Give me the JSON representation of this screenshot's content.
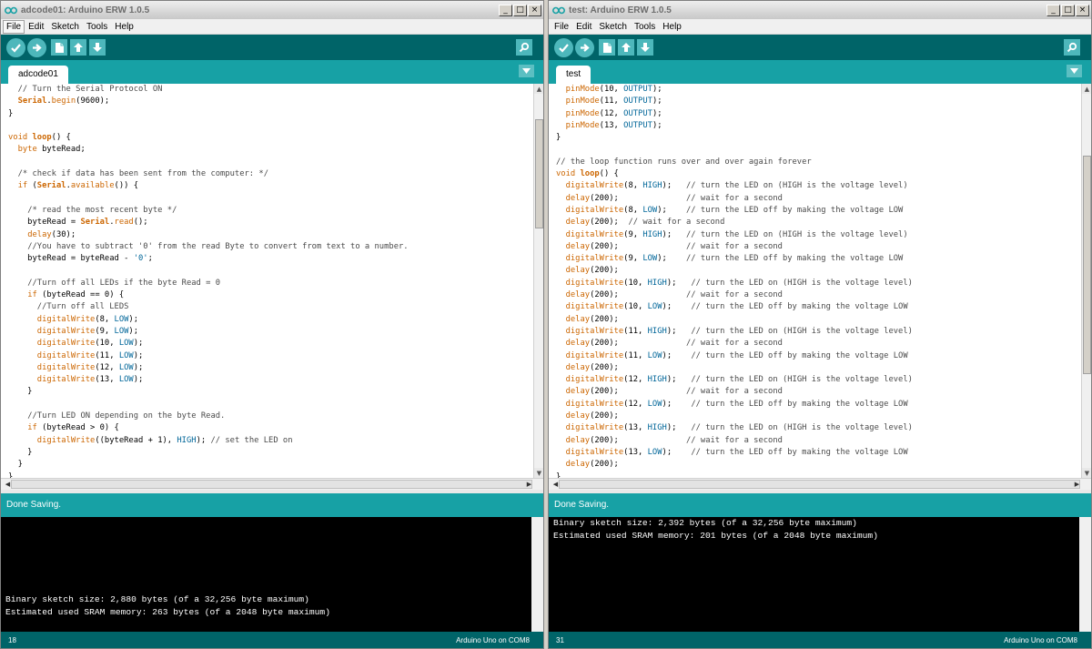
{
  "windows": [
    {
      "title": "adcode01: Arduino ERW 1.0.5",
      "menu": [
        "File",
        "Edit",
        "Sketch",
        "Tools",
        "Help"
      ],
      "tab": "adcode01",
      "status": "Done Saving.",
      "console": [
        "",
        "",
        "",
        "",
        "",
        "",
        "Binary sketch size: 2,880 bytes (of a 32,256 byte maximum)",
        "Estimated used SRAM memory: 263 bytes (of a 2048 byte maximum)"
      ],
      "line_number": "18",
      "board": "Arduino Uno on COM8",
      "code": [
        "  // Turn the Serial Protocol ON",
        "  Serial.begin(9600);",
        "}",
        "",
        "void loop() {",
        "  byte byteRead;",
        "",
        "  /* check if data has been sent from the computer: */",
        "  if (Serial.available()) {",
        "",
        "    /* read the most recent byte */",
        "    byteRead = Serial.read();",
        "    delay(30);",
        "    //You have to subtract '0' from the read Byte to convert from text to a number.",
        "    byteRead = byteRead - '0';",
        "",
        "    //Turn off all LEDs if the byte Read = 0",
        "    if (byteRead == 0) {",
        "      //Turn off all LEDS",
        "      digitalWrite(8, LOW);",
        "      digitalWrite(9, LOW);",
        "      digitalWrite(10, LOW);",
        "      digitalWrite(11, LOW);",
        "      digitalWrite(12, LOW);",
        "      digitalWrite(13, LOW);",
        "    }",
        "",
        "    //Turn LED ON depending on the byte Read.",
        "    if (byteRead > 0) {",
        "      digitalWrite((byteRead + 1), HIGH); // set the LED on",
        "    }",
        "  }",
        "}"
      ]
    },
    {
      "title": "test: Arduino ERW 1.0.5",
      "menu": [
        "File",
        "Edit",
        "Sketch",
        "Tools",
        "Help"
      ],
      "tab": "test",
      "status": "Done Saving.",
      "console": [
        "Binary sketch size: 2,392 bytes (of a 32,256 byte maximum)",
        "Estimated used SRAM memory: 201 bytes (of a 2048 byte maximum)"
      ],
      "line_number": "31",
      "board": "Arduino Uno on COM8",
      "code": [
        "  pinMode(10, OUTPUT);",
        "  pinMode(11, OUTPUT);",
        "  pinMode(12, OUTPUT);",
        "  pinMode(13, OUTPUT);",
        "}",
        "",
        "// the loop function runs over and over again forever",
        "void loop() {",
        "  digitalWrite(8, HIGH);   // turn the LED on (HIGH is the voltage level)",
        "  delay(200);              // wait for a second",
        "  digitalWrite(8, LOW);    // turn the LED off by making the voltage LOW",
        "  delay(200);  // wait for a second",
        "  digitalWrite(9, HIGH);   // turn the LED on (HIGH is the voltage level)",
        "  delay(200);              // wait for a second",
        "  digitalWrite(9, LOW);    // turn the LED off by making the voltage LOW",
        "  delay(200);",
        "  digitalWrite(10, HIGH);   // turn the LED on (HIGH is the voltage level)",
        "  delay(200);              // wait for a second",
        "  digitalWrite(10, LOW);    // turn the LED off by making the voltage LOW",
        "  delay(200);",
        "  digitalWrite(11, HIGH);   // turn the LED on (HIGH is the voltage level)",
        "  delay(200);              // wait for a second",
        "  digitalWrite(11, LOW);    // turn the LED off by making the voltage LOW",
        "  delay(200);",
        "  digitalWrite(12, HIGH);   // turn the LED on (HIGH is the voltage level)",
        "  delay(200);              // wait for a second",
        "  digitalWrite(12, LOW);    // turn the LED off by making the voltage LOW",
        "  delay(200);",
        "  digitalWrite(13, HIGH);   // turn the LED on (HIGH is the voltage level)",
        "  delay(200);              // wait for a second",
        "  digitalWrite(13, LOW);    // turn the LED off by making the voltage LOW",
        "  delay(200);",
        "}"
      ]
    }
  ],
  "icons": {
    "title": "arduino-infinity-icon",
    "toolbar": [
      "verify-icon",
      "upload-icon",
      "new-icon",
      "open-icon",
      "save-icon",
      "serial-monitor-icon"
    ]
  },
  "colors": {
    "toolbar": "#006468",
    "tabbar": "#17a1a5",
    "keyword": "#cc6600",
    "constant": "#006699",
    "button": "#4db7bb"
  }
}
